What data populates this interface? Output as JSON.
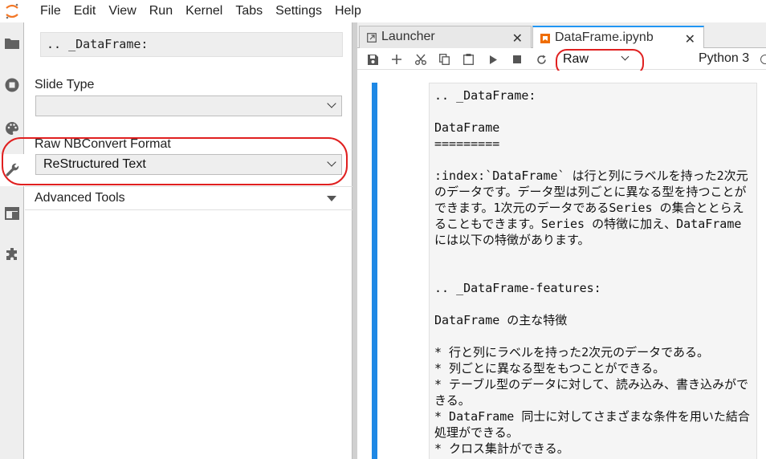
{
  "menubar": {
    "items": [
      "File",
      "Edit",
      "View",
      "Run",
      "Kernel",
      "Tabs",
      "Settings",
      "Help"
    ]
  },
  "leftbar": {
    "icons": [
      "folder-icon",
      "stop-circle-icon",
      "palette-icon",
      "wrench-icon",
      "tab-icon",
      "puzzle-icon"
    ],
    "active": "wrench-icon"
  },
  "inspector": {
    "cell_preview": ".. _DataFrame:",
    "slide_type_label": "Slide Type",
    "slide_type_value": "",
    "raw_format_label": "Raw NBConvert Format",
    "raw_format_value": "ReStructured Text",
    "advanced_tools_label": "Advanced Tools"
  },
  "tabs": [
    {
      "label": "Launcher"
    },
    {
      "label": "DataFrame.ipynb"
    }
  ],
  "toolbar": {
    "cell_type": "Raw",
    "kernel": "Python 3"
  },
  "cell": {
    "source": ".. _DataFrame:\n\nDataFrame\n=========\n\n:index:`DataFrame` は行と列にラベルを持った2次元のデータです。データ型は列ごとに異なる型を持つことができます。1次元のデータであるSeries の集合ととらえることもできます。Series の特徴に加え、DataFrame には以下の特徴があります。\n\n\n.. _DataFrame-features:\n\nDataFrame の主な特徴\n\n* 行と列にラベルを持った2次元のデータである。\n* 列ごとに異なる型をもつことができる。\n* テーブル型のデータに対して、読み込み、書き込みができる。\n* DataFrame 同士に対してさまざまな条件を用いた結合処理ができる。\n* クロス集計ができる。"
  },
  "colors": {
    "accent": "#2196f3",
    "cell_collapser": "#1e88e5",
    "highlight": "#e02020"
  }
}
